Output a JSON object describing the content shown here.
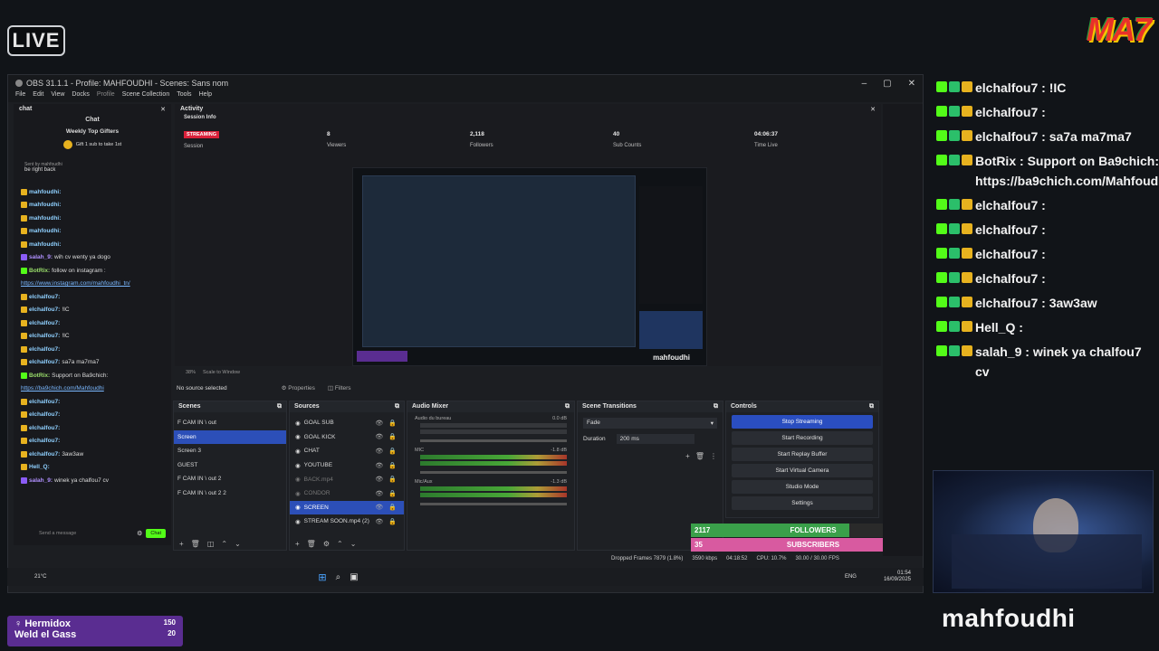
{
  "overlay": {
    "live": "LIVE",
    "brand": "MA7",
    "streamer_name": "mahfoudhi",
    "donor": {
      "name1": "Hermidox",
      "amount1": "150",
      "name2": "Weld el Gass",
      "amount2": "20"
    },
    "followers": {
      "current": "2117",
      "label": "FOLLOWERS",
      "goal": "3000",
      "progress": 0.7
    },
    "subscribers": {
      "current": "35",
      "label": "SUBSCRIBERS",
      "goal": "40",
      "progress": 0.88
    }
  },
  "obs": {
    "title": "OBS 31.1.1 - Profile: MAHFOUDHI - Scenes: Sans nom",
    "menu": [
      "File",
      "Edit",
      "View",
      "Docks",
      "Profile",
      "Scene Collection",
      "Tools",
      "Help"
    ],
    "chat_dock": {
      "title": "chat",
      "header": "Chat",
      "gifters_title": "Weekly Top Gifters",
      "gifters_cta": "Gift 1 sub to take 1st",
      "sent_by": "Sent by mahfoudhi",
      "pinned": "be right back",
      "lines": [
        {
          "user": "mahfoudhi:",
          "msg": "",
          "cls": ""
        },
        {
          "user": "mahfoudhi:",
          "msg": "",
          "cls": ""
        },
        {
          "user": "mahfoudhi:",
          "msg": "",
          "cls": ""
        },
        {
          "user": "mahfoudhi:",
          "msg": "",
          "cls": ""
        },
        {
          "user": "mahfoudhi:",
          "msg": "",
          "cls": ""
        },
        {
          "user": "salah_9:",
          "msg": "wih cv wenty ya dogo",
          "cls": "purple"
        },
        {
          "user": "BotRix:",
          "msg": "follow on instagram :",
          "cls": "green"
        },
        {
          "user": "",
          "msg": "https://www.instagram.com/mahfoudhi_tn/",
          "cls": "link"
        },
        {
          "user": "elchalfou7:",
          "msg": "",
          "cls": ""
        },
        {
          "user": "elchalfou7:",
          "msg": "!IC",
          "cls": ""
        },
        {
          "user": "elchalfou7:",
          "msg": "",
          "cls": ""
        },
        {
          "user": "elchalfou7:",
          "msg": "!IC",
          "cls": ""
        },
        {
          "user": "elchalfou7:",
          "msg": "",
          "cls": ""
        },
        {
          "user": "elchalfou7:",
          "msg": "sa7a ma7ma7",
          "cls": ""
        },
        {
          "user": "BotRix:",
          "msg": "Support on Ba9chich:",
          "cls": "green"
        },
        {
          "user": "",
          "msg": "https://ba9chich.com/Mahfoudhi",
          "cls": "link"
        },
        {
          "user": "elchalfou7:",
          "msg": "",
          "cls": ""
        },
        {
          "user": "elchalfou7:",
          "msg": "",
          "cls": ""
        },
        {
          "user": "elchalfou7:",
          "msg": "",
          "cls": ""
        },
        {
          "user": "elchalfou7:",
          "msg": "",
          "cls": ""
        },
        {
          "user": "elchalfou7:",
          "msg": "3aw3aw",
          "cls": ""
        },
        {
          "user": "Hell_Q:",
          "msg": "",
          "cls": ""
        },
        {
          "user": "salah_9:",
          "msg": "winek ya chalfou7 cv",
          "cls": "purple"
        }
      ],
      "input_placeholder": "Send a message",
      "send_label": "Chat"
    },
    "activity": {
      "title": "Activity",
      "session_info": "Session Info",
      "stats": [
        {
          "value": "STREAMING",
          "label": "Session"
        },
        {
          "value": "8",
          "label": "Viewers"
        },
        {
          "value": "2,118",
          "label": "Followers"
        },
        {
          "value": "40",
          "label": "Sub Counts"
        },
        {
          "value": "04:06:37",
          "label": "Time Live"
        }
      ],
      "preview_name": "mahfoudhi"
    },
    "zoom": "38%",
    "scale_mode": "Scale to Window",
    "no_source": "No source selected",
    "properties_label": "Properties",
    "filters_label": "Filters",
    "scenes": {
      "title": "Scenes",
      "items": [
        "F CAM IN \\ out",
        "Screen",
        "Screen 3",
        "GUEST",
        "F CAM IN \\ out 2",
        "F CAM IN \\ out 2 2"
      ],
      "selected": 1
    },
    "sources": {
      "title": "Sources",
      "items": [
        {
          "name": "GOAL SUB",
          "state": ""
        },
        {
          "name": "GOAL KICK",
          "state": ""
        },
        {
          "name": "CHAT",
          "state": ""
        },
        {
          "name": "YOUTUBE",
          "state": ""
        },
        {
          "name": "BACK.mp4",
          "state": "dim"
        },
        {
          "name": "CONDOR",
          "state": "dim"
        },
        {
          "name": "SCREEN",
          "state": "sel"
        },
        {
          "name": "STREAM SOON.mp4 (2)",
          "state": ""
        }
      ]
    },
    "mixer": {
      "title": "Audio Mixer",
      "channels": [
        {
          "name": "Audio du bureau",
          "db": "0.0 dB",
          "level": 0.0
        },
        {
          "name": "MIC",
          "db": "-1.8 dB",
          "level": 0.88
        },
        {
          "name": "Mic/Aux",
          "db": "-1.3 dB",
          "level": 0.9
        }
      ]
    },
    "transitions": {
      "title": "Scene Transitions",
      "type": "Fade",
      "duration_label": "Duration",
      "duration": "200 ms"
    },
    "controls": {
      "title": "Controls",
      "buttons": [
        "Stop Streaming",
        "Start Recording",
        "Start Replay Buffer",
        "Start Virtual Camera",
        "Studio Mode",
        "Settings"
      ]
    },
    "status": {
      "dropped": "Dropped Frames 7879 (1.8%)",
      "bitrate": "3590 kbps",
      "time": "04:18:52",
      "cpu": "CPU: 10.7%",
      "fps": "30.00 / 30.00 FPS"
    }
  },
  "right_chat": [
    {
      "user": "elchalfou7",
      "msg": ": !IC"
    },
    {
      "user": "elchalfou7",
      "msg": ":"
    },
    {
      "user": "elchalfou7",
      "msg": ": sa7a ma7ma7"
    },
    {
      "user": "BotRix",
      "msg": ": Support on Ba9chich: https://ba9chich.com/Mahfoudhi"
    },
    {
      "user": "elchalfou7",
      "msg": ":"
    },
    {
      "user": "elchalfou7",
      "msg": ":"
    },
    {
      "user": "elchalfou7",
      "msg": ":"
    },
    {
      "user": "elchalfou7",
      "msg": ":"
    },
    {
      "user": "elchalfou7",
      "msg": ": 3aw3aw"
    },
    {
      "user": "Hell_Q",
      "msg": ":"
    },
    {
      "user": "salah_9",
      "msg": ": winek ya chalfou7 cv"
    }
  ],
  "taskbar": {
    "weather": "21°C",
    "lang": "ENG",
    "clock": "01:54",
    "date": "16/09/2025"
  },
  "colors": {
    "accent": "#2a4ec0",
    "live_red": "#d9213a",
    "kick_green": "#53fc18",
    "follower_green": "#3aa04a",
    "sub_pink": "#d85aa0"
  }
}
